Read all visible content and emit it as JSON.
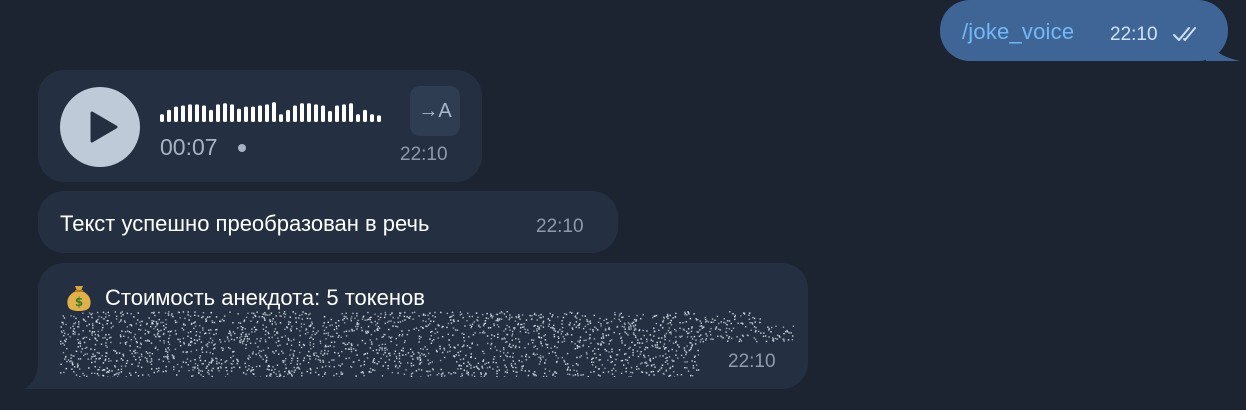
{
  "outgoing": {
    "text": "/joke_voice",
    "time": "22:10",
    "status_icon": "double-check-icon"
  },
  "voice_message": {
    "duration": "00:07",
    "time": "22:10",
    "transcribe_label": "→A",
    "waveform_levels": [
      0.35,
      0.55,
      0.7,
      0.75,
      0.8,
      0.8,
      0.75,
      0.55,
      0.8,
      0.85,
      0.8,
      0.6,
      0.7,
      0.7,
      0.75,
      0.8,
      0.9,
      0.35,
      0.55,
      0.75,
      0.85,
      0.85,
      0.8,
      0.75,
      0.5,
      0.75,
      0.8,
      0.85,
      0.35,
      0.55,
      0.35,
      0.3
    ]
  },
  "text_message": {
    "text": "Текст успешно преобразован в речь",
    "time": "22:10"
  },
  "cost_message": {
    "icon": "money-bag-icon",
    "text": "Стоимость анекдота: 5 токенов",
    "time": "22:10"
  },
  "colors": {
    "background": "#1b2430",
    "incoming_bubble": "#243041",
    "outgoing_bubble": "#3f6596",
    "link": "#74b8f5"
  }
}
